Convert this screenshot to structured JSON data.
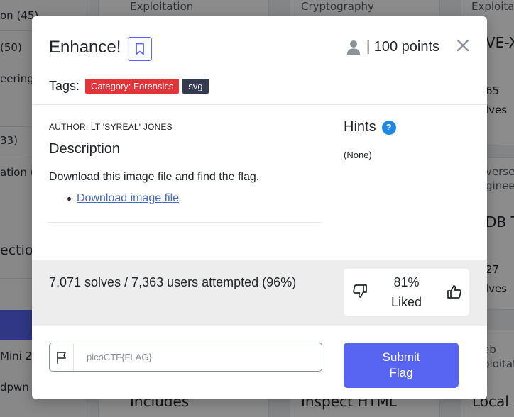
{
  "background": {
    "sidebar_items": [
      "on (45)",
      "(50)",
      "eering",
      "33)",
      "ation (3",
      "ection",
      "Mini 20",
      "dpwn"
    ],
    "cards": {
      "c1_category": "Exploitation",
      "c2_category": "Cryptography",
      "c3_category": "Exploitat",
      "c3_title": "VE-XX",
      "c3_solves_num": "65",
      "c3_solves_label": "lves",
      "c4_category_line1": "verse",
      "c4_category_line2": "gineer",
      "c4_title": "DB To",
      "c4_solves_num": "27",
      "c4_solves_label": "lves",
      "c5_category_line1": "eb",
      "c5_category_line2": "ploitat",
      "c5_title": "Local A",
      "c6_title": "Includes",
      "c7_title": "Inspect HTML"
    }
  },
  "modal": {
    "title": "Enhance!",
    "points": "| 100 points",
    "tags_label": "Tags:",
    "tags": [
      "Category: Forensics",
      "svg"
    ],
    "author": "AUTHOR: LT 'SYREAL' JONES",
    "description_heading": "Description",
    "description_text": "Download this image file and find the flag.",
    "download_link": "Download image file",
    "hints_heading": "Hints",
    "hints_help_glyph": "?",
    "hints_value": "(None)",
    "solves": "7,071 solves / 7,363 users attempted (96%)",
    "like_percent": "81%",
    "like_label": "Liked",
    "flag_placeholder": "picoCTF{FLAG}",
    "submit_label": "Submit Flag"
  },
  "colors": {
    "accent": "#5865f2",
    "category_tag": "#e3343a",
    "svg_tag": "#343a4f",
    "hint_icon": "#1e88e5",
    "link": "#4a69bd"
  }
}
